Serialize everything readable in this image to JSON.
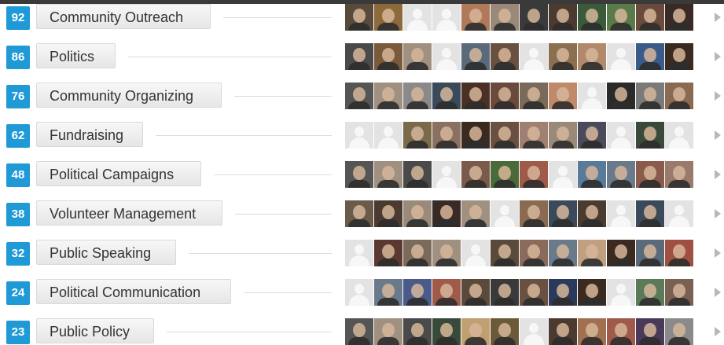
{
  "skills": [
    {
      "count": "92",
      "name": "Community Outreach",
      "endorsers": [
        "#5a4a3c",
        "#8c6a3a",
        "p",
        "p",
        "#b07a5a",
        "#9a8878",
        "#3a3a3a",
        "#4a3a30",
        "#3a5a3a",
        "#5a7a4a",
        "#6a4a3a",
        "#3a2a25"
      ]
    },
    {
      "count": "86",
      "name": "Politics",
      "endorsers": [
        "#4a4a4a",
        "#7a5a3a",
        "#a09080",
        "p",
        "#5a6a7a",
        "#6a5040",
        "p",
        "#8a7050",
        "#b08a6a",
        "p",
        "#3a5a8a",
        "#3a2a20"
      ]
    },
    {
      "count": "76",
      "name": "Community Organizing",
      "endorsers": [
        "#555555",
        "#a09080",
        "#8a8a8a",
        "#3a4a5a",
        "#4a3025",
        "#6a4a3a",
        "#7a6a5a",
        "#c08a6a",
        "p",
        "#2a2a2a",
        "#7a7a7a",
        "#8a6a50"
      ]
    },
    {
      "count": "62",
      "name": "Fundraising",
      "endorsers": [
        "p",
        "p",
        "#7a6a4a",
        "#8a7060",
        "#3a2a20",
        "#6a5040",
        "#a08070",
        "#9a8878",
        "#4a4a5a",
        "p",
        "#3a4a3a",
        "p"
      ]
    },
    {
      "count": "48",
      "name": "Political Campaigns",
      "endorsers": [
        "#555555",
        "#a09080",
        "#4a4a4a",
        "p",
        "#7a5a4a",
        "#4a6a3a",
        "#a05a4a",
        "p",
        "#5a7a9a",
        "#6a7a8a",
        "#8a5a4a",
        "#9a7a6a"
      ]
    },
    {
      "count": "38",
      "name": "Volunteer Management",
      "endorsers": [
        "#6a5a4a",
        "#4a3a30",
        "#9a8a7a",
        "#3a2a25",
        "#a09080",
        "p",
        "#8a6a50",
        "#3a4a5a",
        "#4a3a30",
        "p",
        "#3a4a5a",
        "p"
      ]
    },
    {
      "count": "32",
      "name": "Public Speaking",
      "endorsers": [
        "p",
        "#5a3a30",
        "#7a6a5a",
        "#a09080",
        "p",
        "#5a4a3a",
        "#8a6a5a",
        "#6a7a8a",
        "#c0a080",
        "#3a2a20",
        "#5a6a7a",
        "#a05040"
      ]
    },
    {
      "count": "24",
      "name": "Political Communication",
      "endorsers": [
        "p",
        "#6a7a8a",
        "#4a5a8a",
        "#a05a4a",
        "#5a4a3a",
        "#3a3a3a",
        "#6a5040",
        "#2a3a5a",
        "#3a2a20",
        "p",
        "#5a7a5a",
        "#7a6050"
      ]
    },
    {
      "count": "23",
      "name": "Public Policy",
      "endorsers": [
        "#555555",
        "#a09080",
        "#4a4a4a",
        "#3a4a3a",
        "#c0a070",
        "#6a5a3a",
        "p",
        "#4a3a30",
        "#a07050",
        "#a05a4a",
        "#4a3a5a",
        "#8a8a8a"
      ]
    }
  ]
}
